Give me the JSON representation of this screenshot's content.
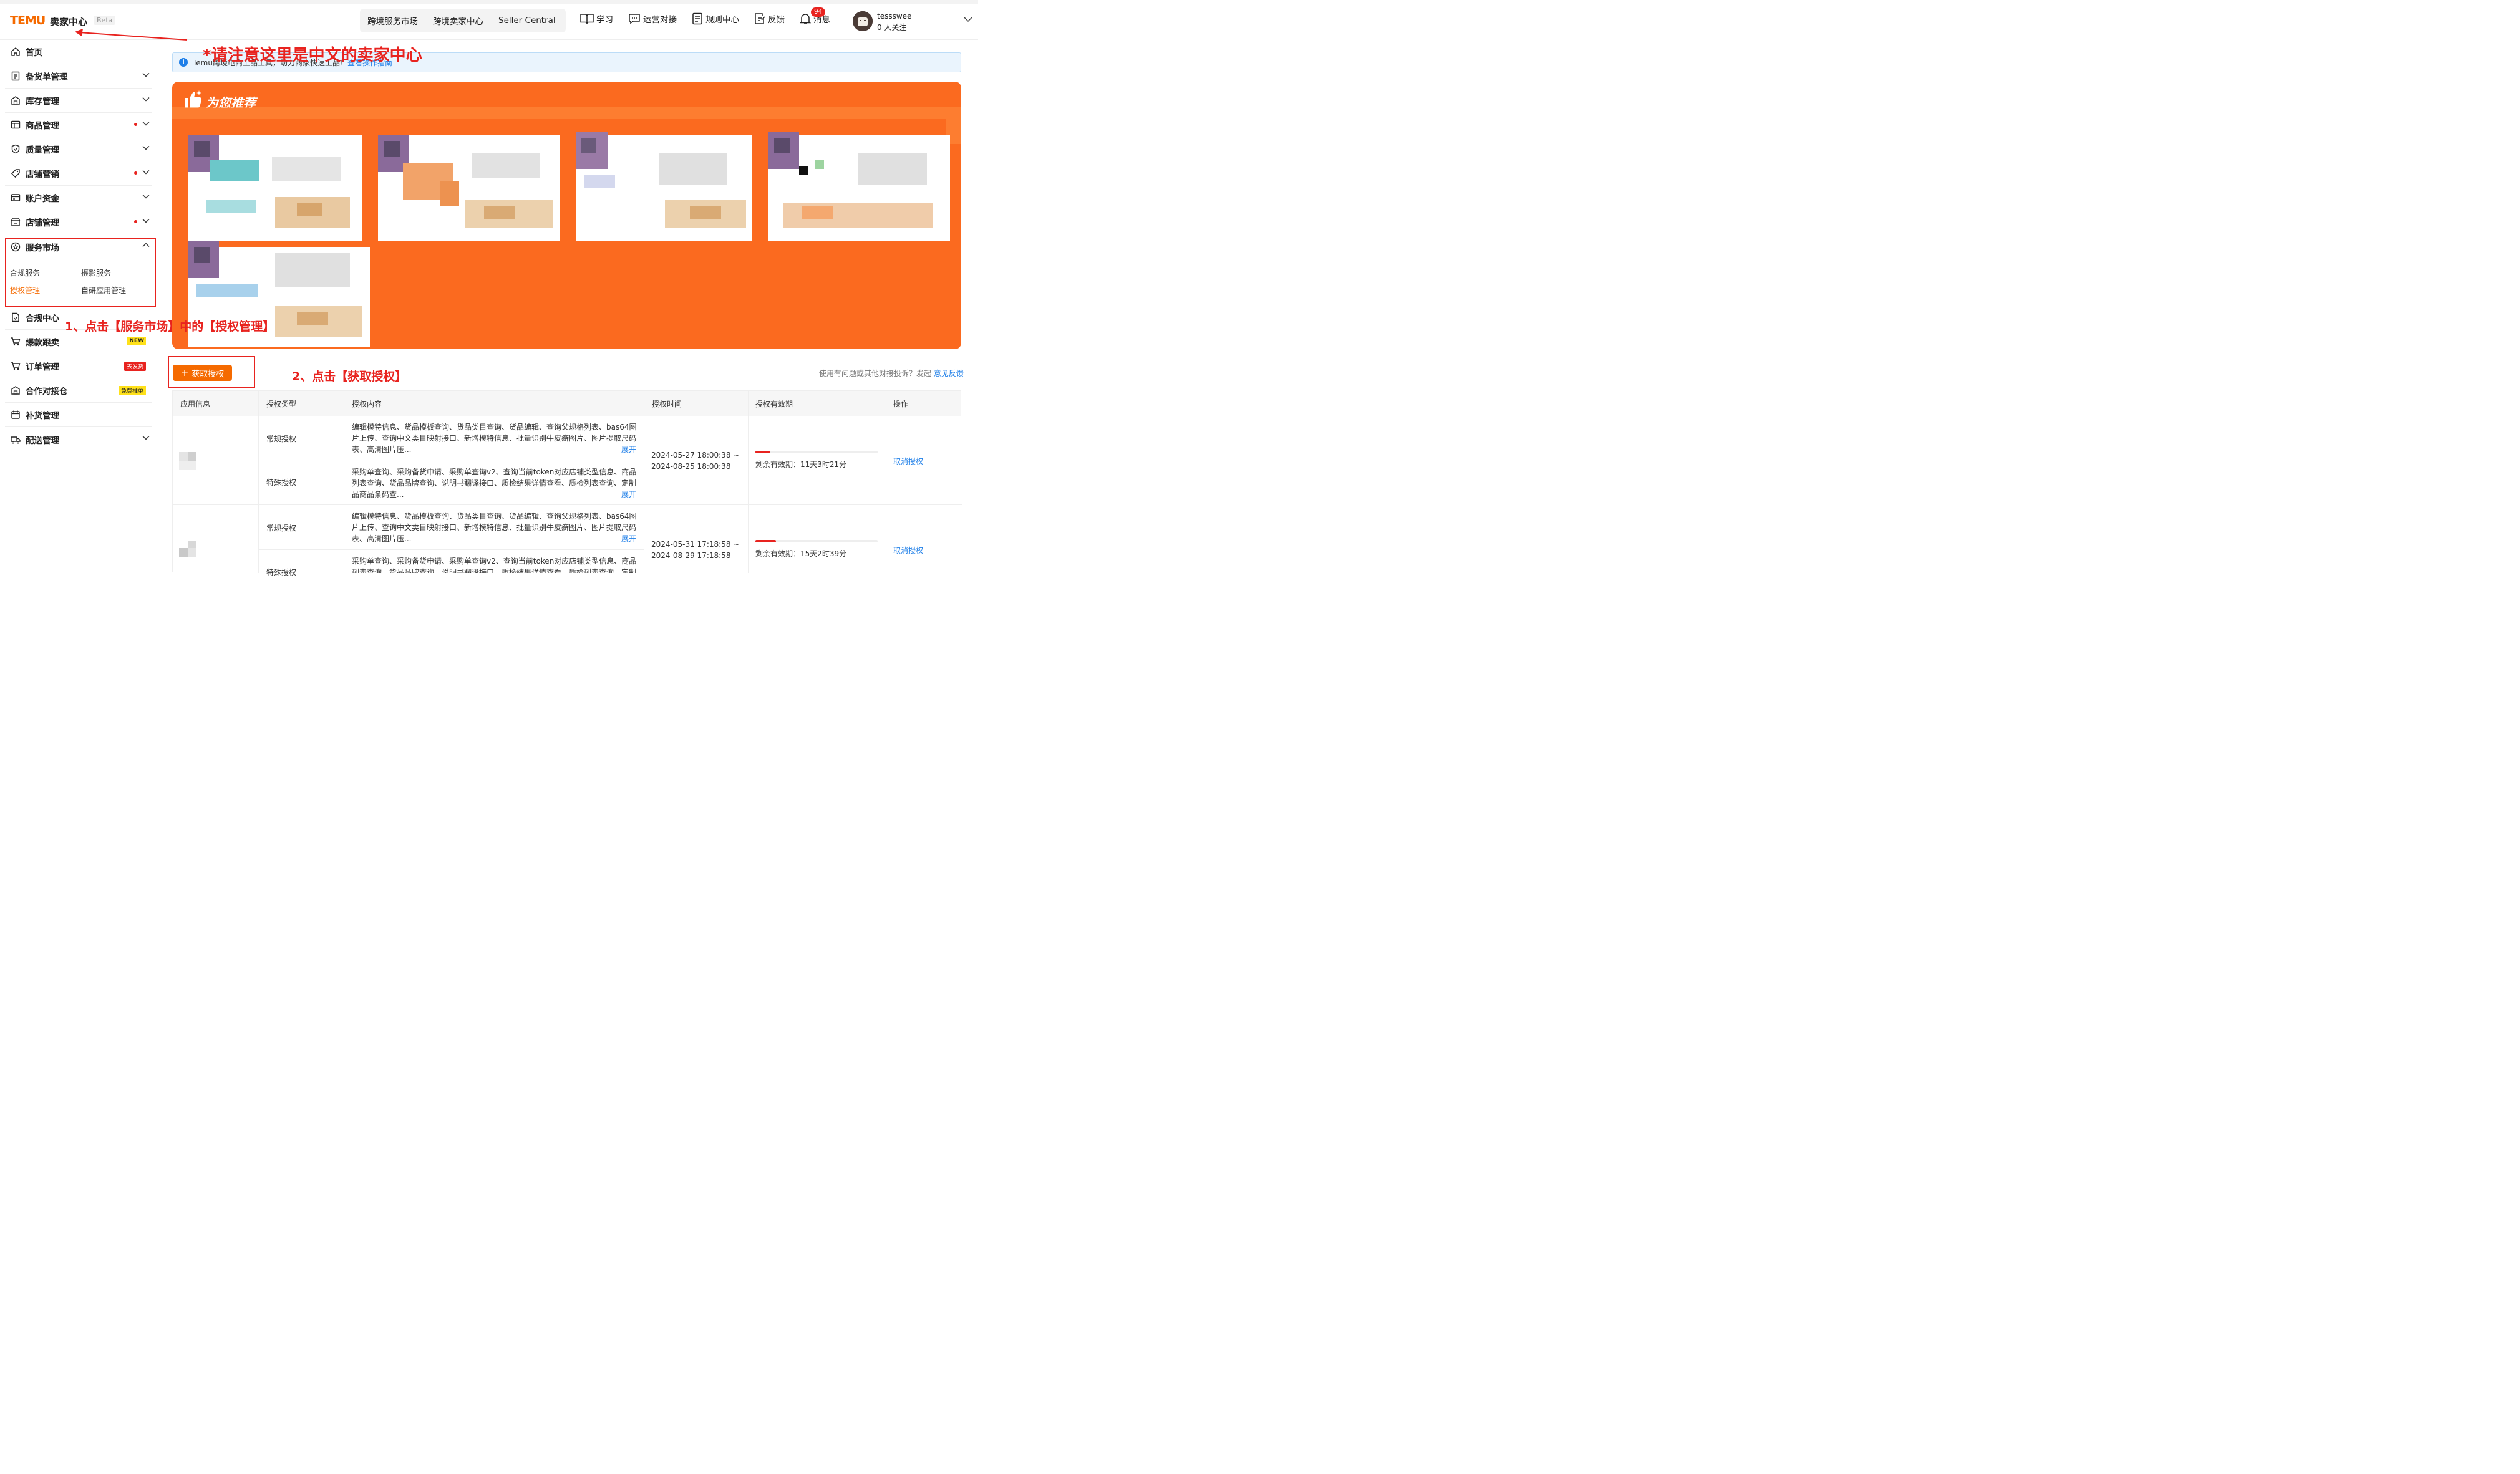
{
  "header": {
    "logo": "TEMU",
    "logo_sub": "卖家中心",
    "beta": "Beta",
    "nav": [
      "跨境服务市场",
      "跨境卖家中心",
      "Seller Central"
    ],
    "tools": [
      {
        "label": "学习",
        "icon": "book-icon"
      },
      {
        "label": "运营对接",
        "icon": "chat-icon"
      },
      {
        "label": "规则中心",
        "icon": "rules-icon"
      },
      {
        "label": "反馈",
        "icon": "feedback-icon"
      },
      {
        "label": "消息",
        "icon": "bell-icon"
      }
    ],
    "message_badge": "94",
    "user_name": "tessswee",
    "user_follow": "0 人关注"
  },
  "sidebar": {
    "items": [
      {
        "label": "首页"
      },
      {
        "label": "备货单管理"
      },
      {
        "label": "库存管理"
      },
      {
        "label": "商品管理"
      },
      {
        "label": "质量管理"
      },
      {
        "label": "店铺营销"
      },
      {
        "label": "账户资金"
      },
      {
        "label": "店铺管理"
      },
      {
        "label": "服务市场"
      },
      {
        "label": "合规中心"
      },
      {
        "label": "爆款跟卖",
        "tag": "NEW"
      },
      {
        "label": "订单管理",
        "tag": "去发货"
      },
      {
        "label": "合作对接仓",
        "tag": "免费推单"
      },
      {
        "label": "补货管理"
      },
      {
        "label": "配送管理"
      }
    ],
    "sub_items": [
      "合规服务",
      "摄影服务",
      "授权管理",
      "自研应用管理"
    ]
  },
  "annotations": {
    "note_top": "*请注意这里是中文的卖家中心",
    "step1": "1、点击【服务市场】中的【授权管理】",
    "step2": "2、点击【获取授权】"
  },
  "info": {
    "text": "Temu跨境电商上品工具，助力商家快速上品！",
    "link": "查看操作指南"
  },
  "banner": {
    "title": "为您推荐"
  },
  "actions": {
    "get_auth": "获取授权",
    "feedback_text": "使用有问题或其他对接投诉？发起",
    "feedback_link": "意见反馈"
  },
  "table": {
    "headers": [
      "应用信息",
      "授权类型",
      "授权内容",
      "授权时间",
      "授权有效期",
      "操作"
    ],
    "rows": [
      {
        "sub": [
          {
            "type": "常规授权",
            "content": "编辑模特信息、货品模板查询、货品类目查询、货品编辑、查询父规格列表、bas64图片上传、查询中文类目映射接口、新增模特信息、批量识别牛皮癣图片、图片提取尺码表、高清图片压...",
            "more": "展开"
          },
          {
            "type": "特殊授权",
            "content": "采购单查询、采购备货申请、采购单查询v2、查询当前token对应店铺类型信息、商品列表查询、货品品牌查询、说明书翻译接口、质检结果详情查看、质检列表查询、定制品商品条码查...",
            "more": "展开"
          }
        ],
        "time": "2024-05-27 18:00:38 ~\n2024-08-25 18:00:38",
        "validity": "剩余有效期：11天3时21分",
        "progress": 0.12,
        "action": "取消授权"
      },
      {
        "sub": [
          {
            "type": "常规授权",
            "content": "编辑模特信息、货品模板查询、货品类目查询、货品编辑、查询父规格列表、bas64图片上传、查询中文类目映射接口、新增模特信息、批量识别牛皮癣图片、图片提取尺码表、高清图片压...",
            "more": "展开"
          },
          {
            "type": "特殊授权",
            "content": "采购单查询、采购备货申请、采购单查询v2、查询当前token对应店铺类型信息、商品列表查询、货品品牌查询、说明书翻译接口、质检结果详情查看、质检列表查询、定制品",
            "more": ""
          }
        ],
        "time": "2024-05-31 17:18:58 ~\n2024-08-29 17:18:58",
        "validity": "剩余有效期：15天2时39分",
        "progress": 0.17,
        "action": "取消授权"
      }
    ]
  },
  "colors": {
    "accent": "#f56a00",
    "annotation": "#e8231f",
    "link": "#1f7fe8"
  }
}
